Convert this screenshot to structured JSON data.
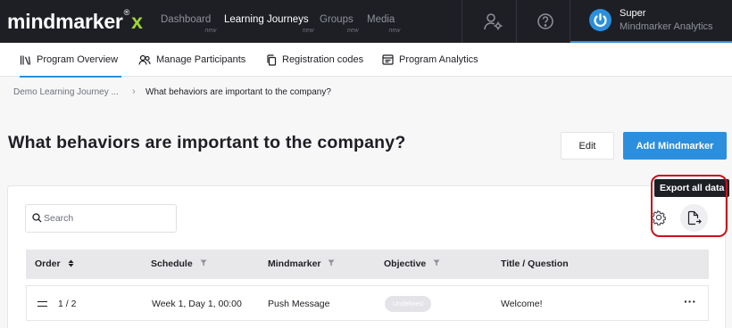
{
  "brand": {
    "name": "mindmarker",
    "x": "x",
    "reg": "®"
  },
  "nav": {
    "items": [
      {
        "label": "Dashboard",
        "sub": "new"
      },
      {
        "label": "Learning Journeys",
        "sub": "new"
      },
      {
        "label": "Groups",
        "sub": "new"
      },
      {
        "label": "Media",
        "sub": "new"
      }
    ],
    "icons": [
      "user-settings-icon",
      "help-icon"
    ]
  },
  "user": {
    "name": "Super",
    "org": "Mindmarker Analytics",
    "avatar_icon": "power-icon"
  },
  "tabs": [
    {
      "label": "Program Overview",
      "icon": "library-icon"
    },
    {
      "label": "Manage Participants",
      "icon": "users-icon"
    },
    {
      "label": "Registration codes",
      "icon": "copy-icon"
    },
    {
      "label": "Program Analytics",
      "icon": "analytics-icon"
    }
  ],
  "breadcrumb": {
    "parent": "Demo Learning Journey ...",
    "separator": "›",
    "current": "What behaviors are important to the company?"
  },
  "page": {
    "title": "What behaviors are important to the company?"
  },
  "actions": {
    "edit": "Edit",
    "add": "Add Mindmarker"
  },
  "search": {
    "placeholder": "Search",
    "value": ""
  },
  "toolbar": {
    "tooltip": "Export all data",
    "gear_icon": "gear-icon",
    "export_icon": "export-file-icon"
  },
  "table": {
    "columns": [
      "Order",
      "Schedule",
      "Mindmarker",
      "Objective",
      "Title / Question"
    ],
    "rows": [
      {
        "order": "1 / 2",
        "schedule": "Week 1, Day 1, 00:00",
        "mindmarker": "Push Message",
        "objective": "Undefined",
        "title": "Welcome!",
        "more": "···"
      }
    ]
  },
  "colors": {
    "accent": "#2b8fdd",
    "nav_bg": "#1e1f25",
    "brand_x": "#9ed63a",
    "highlight": "#c4131b"
  }
}
